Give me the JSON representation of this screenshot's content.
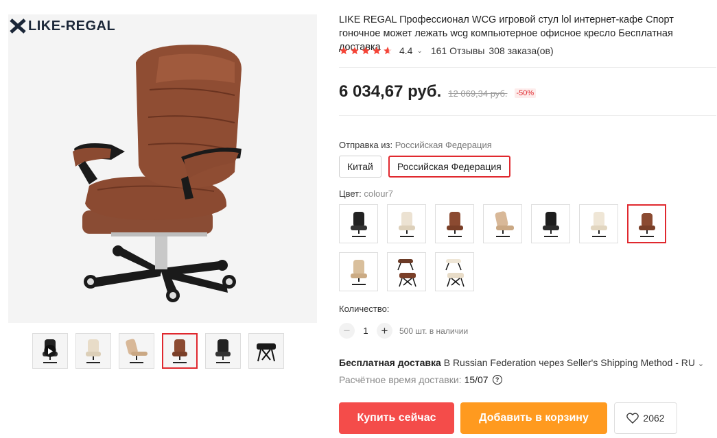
{
  "brand": {
    "logo_text": "LIKE-REGAL"
  },
  "gallery": {
    "main_alt": "brown office chair",
    "thumbs": [
      {
        "chair": "black",
        "video": true,
        "selected": false
      },
      {
        "chair": "cream",
        "selected": false
      },
      {
        "chair": "beige-reclined",
        "selected": false
      },
      {
        "chair": "brown",
        "selected": true
      },
      {
        "chair": "black",
        "selected": false
      },
      {
        "chair": "ottoman",
        "selected": false
      }
    ]
  },
  "product": {
    "title": "LIKE REGAL Профессионал WCG игровой стул lol интернет-кафе Спорт гоночное может лежать wcg компьютерное офисное кресло Бесплатная доставка",
    "rating": "4.4",
    "reviews": "161 Отзывы",
    "orders": "308 заказа(ов)"
  },
  "price": {
    "current": "6 034,67 руб.",
    "old": "12 069,34 руб.",
    "discount": "-50%"
  },
  "ship_from": {
    "label": "Отправка из:",
    "value": "Российская Федерация",
    "options": [
      "Китай",
      "Российская Федерация"
    ],
    "selected_index": 1
  },
  "color": {
    "label": "Цвет:",
    "value": "colour7",
    "swatches": [
      {
        "chair": "black"
      },
      {
        "chair": "cream"
      },
      {
        "chair": "brown"
      },
      {
        "chair": "beige-reclined"
      },
      {
        "chair": "black"
      },
      {
        "chair": "cream"
      },
      {
        "chair": "brown",
        "selected": true
      },
      {
        "chair": "beige"
      },
      {
        "chair": "brown-ottoman"
      },
      {
        "chair": "cream-ottoman"
      }
    ]
  },
  "quantity": {
    "label": "Количество:",
    "value": "1",
    "minus": "−",
    "plus": "+",
    "stock": "500 шт. в наличии"
  },
  "delivery": {
    "free_label": "Бесплатная доставка",
    "details": " В Russian Federation через Seller's Shipping Method - RU",
    "eta_label": "Расчётное время доставки:",
    "eta_date": "15/07"
  },
  "actions": {
    "buy": "Купить сейчас",
    "cart": "Добавить в корзину",
    "wishlist_count": "2062"
  },
  "colors": {
    "accent_red": "#e0282e",
    "buy_button": "#f44c4a",
    "cart_button": "#ff9a1f",
    "star": "#f44336"
  }
}
